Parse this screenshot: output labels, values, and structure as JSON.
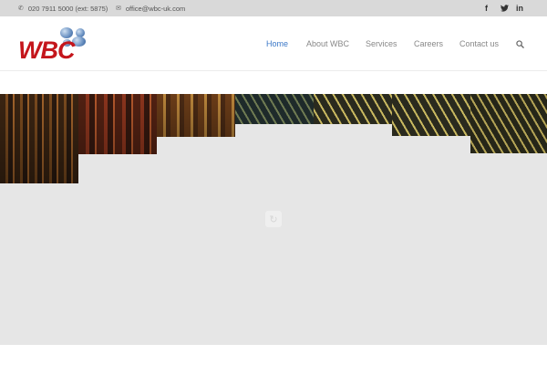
{
  "topbar": {
    "phone": "020 7911 5000 (ext: 5875)",
    "phone_icon": "phone-icon",
    "email": "office@wbc-uk.com",
    "email_icon": "envelope-icon",
    "social": [
      {
        "name": "facebook-icon",
        "glyph": "f"
      },
      {
        "name": "twitter-icon",
        "glyph": "🐦"
      },
      {
        "name": "linkedin-icon",
        "glyph": "in"
      }
    ]
  },
  "header": {
    "logo_text": "WBC",
    "nav": [
      "Home",
      "About WBC",
      "Services",
      "Careers",
      "Contact us"
    ],
    "active_nav": "Home",
    "search_icon": "search-icon"
  },
  "colors": {
    "brand_red": "#c4161c",
    "nav_active": "#3b78c8",
    "topbar_bg": "#d9d9d9",
    "hero_bg": "#e6e6e6"
  },
  "hero": {
    "loader_icon": "loading-spinner-icon"
  }
}
